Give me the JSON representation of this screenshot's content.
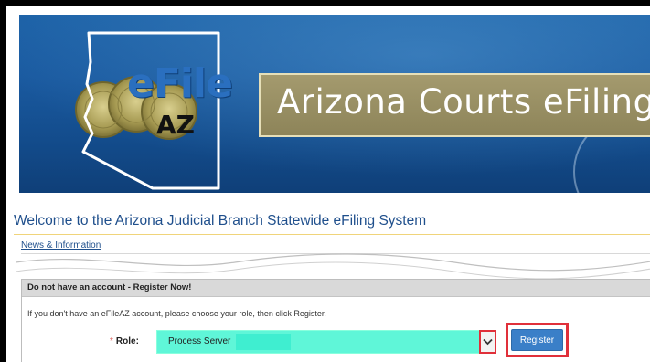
{
  "banner": {
    "logo_efile": "eFile",
    "logo_az": "AZ",
    "title": "Arizona Courts eFiling"
  },
  "welcome": {
    "title": "Welcome to the Arizona Judicial Branch Statewide eFiling System",
    "news_link": "News & Information"
  },
  "register_panel": {
    "header": "Do not have an account - Register Now!",
    "info": "If you don't have an eFileAZ account, please choose your role, then click Register.",
    "required_mark": "*",
    "role_label": "Role:",
    "role_value": "Process Server",
    "register_label": "Register"
  },
  "colors": {
    "banner_blue": "#1a5aa0",
    "title_box": "#9a9064",
    "role_select_bg": "#5ff6d8",
    "register_button": "#3a7fc8",
    "highlight_red": "#e0303a",
    "welcome_text": "#1f4f8c"
  },
  "icons": {
    "dropdown": "chevron-down-icon",
    "map": "arizona-map-icon",
    "seal": "seal-icon"
  }
}
